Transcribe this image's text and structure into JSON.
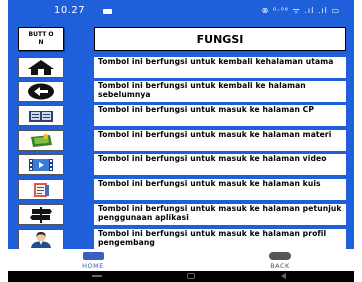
{
  "status_bar": {
    "time": "10.27",
    "icons": "⊗ ⁰·⁰⁶ ᯤ .ıl .ıl ▭"
  },
  "header": {
    "button_label": "BUTT ON",
    "title": "FUNGSI"
  },
  "rows": [
    {
      "icon": "home-icon",
      "text": "Tombol ini berfungsi untuk kembali kehalaman utama"
    },
    {
      "icon": "back-arrow-icon",
      "text": "Tombol ini berfungsi untuk kembali ke halaman sebelumnya"
    },
    {
      "icon": "book-icon",
      "text": "Tombol ini berfungsi untuk masuk ke halaman CP"
    },
    {
      "icon": "material-icon",
      "text": "Tombol ini berfungsi untuk masuk ke halaman materi"
    },
    {
      "icon": "video-icon",
      "text": "Tombol ini berfungsi untuk masuk ke halaman video"
    },
    {
      "icon": "quiz-icon",
      "text": "Tombol ini berfungsi untuk masuk ke halaman kuis"
    },
    {
      "icon": "signpost-icon",
      "text": "Tombol ini berfungsi untuk masuk ke halaman petunjuk penggunaan aplikasi"
    },
    {
      "icon": "developer-profile-icon",
      "text": "Tombol ini berfungsi untuk masuk ke halaman profil pengembang"
    }
  ],
  "bottom_nav": {
    "home_label": "HOME",
    "back_label": "BACK"
  },
  "colors": {
    "background": "#1f5fd9",
    "accent": "#3b5fc0"
  }
}
